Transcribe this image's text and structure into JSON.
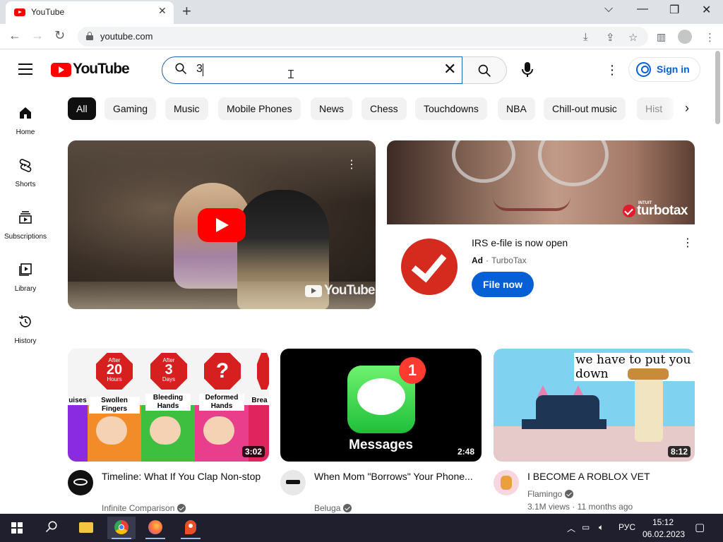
{
  "browser": {
    "tab_title": "YouTube",
    "url": "youtube.com"
  },
  "header": {
    "logo_text": "YouTube",
    "search_value": "3",
    "signin_label": "Sign in"
  },
  "sidebar": {
    "items": [
      {
        "label": "Home",
        "icon": "home-icon"
      },
      {
        "label": "Shorts",
        "icon": "shorts-icon"
      },
      {
        "label": "Subscriptions",
        "icon": "subscriptions-icon"
      },
      {
        "label": "Library",
        "icon": "library-icon"
      },
      {
        "label": "History",
        "icon": "history-icon"
      }
    ]
  },
  "chips": [
    "All",
    "Gaming",
    "Music",
    "Mobile Phones",
    "News",
    "Chess",
    "Touchdowns",
    "NBA",
    "Chill-out music",
    "Hist"
  ],
  "hero": {
    "watermark": "YouTube"
  },
  "ad": {
    "brand_word": "turbotax",
    "brand_intuit": "INTUIT",
    "title": "IRS e-file is now open",
    "label": "Ad",
    "separator": "·",
    "channel": "TurboTax",
    "cta": "File now"
  },
  "videos": [
    {
      "title": "Timeline: What If You Clap Non-stop",
      "channel": "Infinite Comparison",
      "duration": "3:02",
      "meta": "",
      "thumb": {
        "labels": [
          "uises",
          "Swollen Fingers",
          "Bleeding Hands",
          "Deformed Hands",
          "Brea"
        ],
        "signs": [
          {
            "small": "After",
            "big": "20",
            "unit": "Hours"
          },
          {
            "small": "After",
            "big": "3",
            "unit": "Days"
          },
          {
            "small": "",
            "big": "?",
            "unit": ""
          }
        ]
      }
    },
    {
      "title": "When Mom \"Borrows\" Your Phone...",
      "channel": "Beluga",
      "duration": "2:48",
      "meta": "",
      "thumb": {
        "badge": "1",
        "label": "Messages"
      }
    },
    {
      "title": "I BECOME A ROBLOX VET",
      "channel": "Flamingo",
      "duration": "8:12",
      "meta": "3.1M views · 11 months ago",
      "thumb": {
        "caption": "we have to put you down"
      }
    }
  ],
  "taskbar": {
    "lang": "РУС",
    "time": "15:12",
    "date": "06.02.2023"
  },
  "colors": {
    "brand_red": "#ff0000",
    "link_blue": "#065fd4",
    "chip_bg": "#f2f2f2",
    "taskbar_bg": "#1f1f2e"
  }
}
